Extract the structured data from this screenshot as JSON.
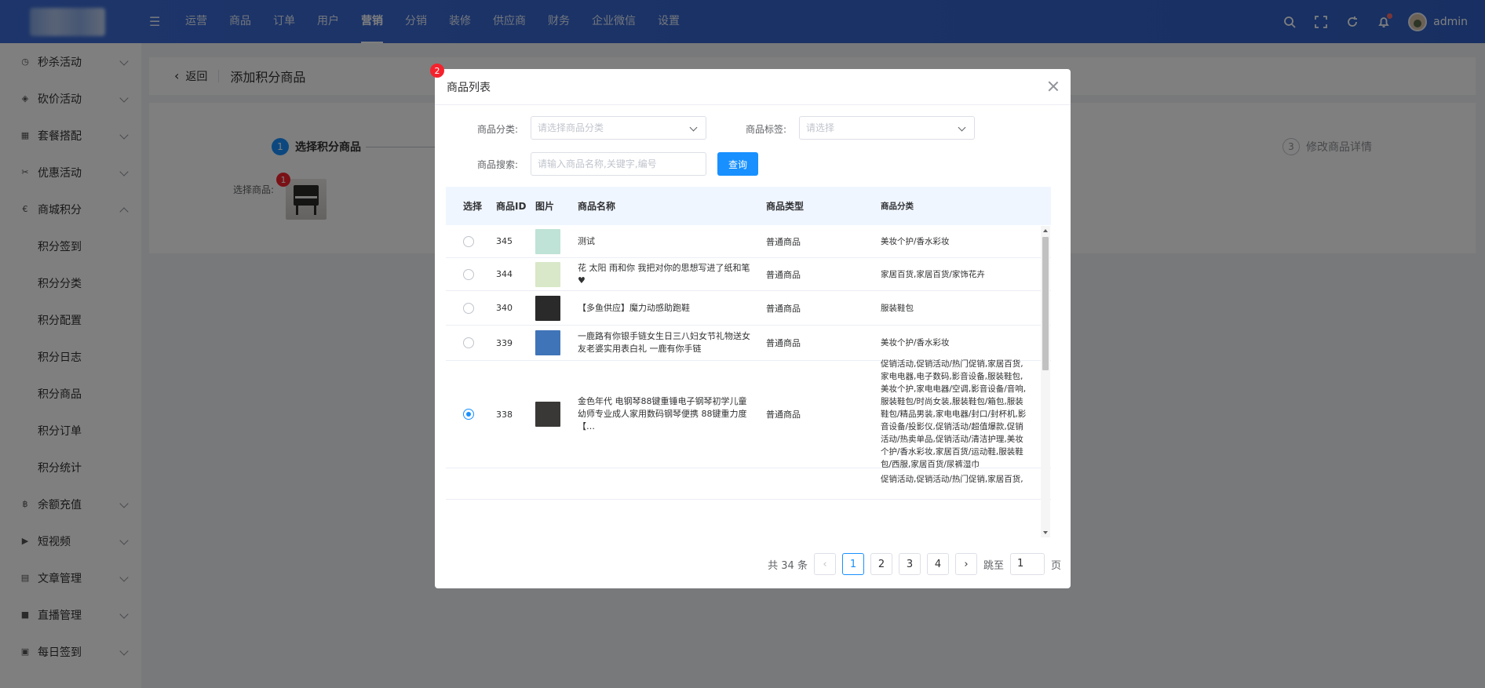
{
  "topnav": {
    "items": [
      "运营",
      "商品",
      "订单",
      "用户",
      "营销",
      "分销",
      "装修",
      "供应商",
      "财务",
      "企业微信",
      "设置"
    ],
    "active": "营销",
    "user": "admin"
  },
  "sidebar": {
    "groups": [
      {
        "label": "秒杀活动",
        "icon": "clock-icon"
      },
      {
        "label": "砍价活动",
        "icon": "tag-icon"
      },
      {
        "label": "套餐搭配",
        "icon": "box-icon"
      },
      {
        "label": "优惠活动",
        "icon": "coupon-icon"
      },
      {
        "label": "商城积分",
        "icon": "euro-icon",
        "expanded": true
      }
    ],
    "subitems": [
      "积分签到",
      "积分分类",
      "积分配置",
      "积分日志",
      "积分商品",
      "积分订单",
      "积分统计"
    ],
    "groups_after": [
      {
        "label": "余额充值",
        "icon": "bitcoin-icon"
      },
      {
        "label": "短视频",
        "icon": "video-icon"
      },
      {
        "label": "文章管理",
        "icon": "article-icon"
      },
      {
        "label": "直播管理",
        "icon": "camera-icon"
      },
      {
        "label": "每日签到",
        "icon": "calendar-icon"
      }
    ]
  },
  "page": {
    "back": "返回",
    "title": "添加积分商品",
    "step1_num": "1",
    "step1_label": "选择积分商品",
    "step3_num": "3",
    "step3_label": "修改商品详情",
    "select_label": "选择商品:",
    "badge1": "1"
  },
  "modal": {
    "title": "商品列表",
    "badge2": "2",
    "filters": {
      "category_label": "商品分类:",
      "category_placeholder": "请选择商品分类",
      "tag_label": "商品标签:",
      "tag_placeholder": "请选择",
      "search_label": "商品搜索:",
      "search_placeholder": "请输入商品名称,关键字,编号",
      "query_button": "查询"
    },
    "columns": [
      "选择",
      "商品ID",
      "图片",
      "商品名称",
      "商品类型",
      "商品分类"
    ],
    "rows": [
      {
        "id": "345",
        "name": "测试",
        "type": "普通商品",
        "category": "美妆个护/香水彩妆",
        "selected": false,
        "thumb": "#bfe3d6"
      },
      {
        "id": "344",
        "name": "花 太阳 雨和你 我把对你的思想写进了纸和笔♥",
        "type": "普通商品",
        "category": "家居百货,家居百货/家饰花卉",
        "selected": false,
        "thumb": "#d8e8c8"
      },
      {
        "id": "340",
        "name": "【多鱼供应】魔力动感助跑鞋",
        "type": "普通商品",
        "category": "服装鞋包",
        "selected": false,
        "thumb": "#2a2a2a"
      },
      {
        "id": "339",
        "name": "一鹿路有你银手链女生日三八妇女节礼物送女友老婆实用表白礼 一鹿有你手链",
        "type": "普通商品",
        "category": "美妆个护/香水彩妆",
        "selected": false,
        "thumb": "#3f74b8"
      },
      {
        "id": "338",
        "name": "金色年代 电钢琴88键重锤电子钢琴初学儿童幼师专业成人家用数码钢琴便携 88键重力度【…",
        "type": "普通商品",
        "category": "促销活动,促销活动/热门促销,家居百货,家电电器,电子数码,影音设备,服装鞋包,美妆个护,家电电器/空调,影音设备/音响,服装鞋包/时尚女装,服装鞋包/箱包,服装鞋包/精品男装,家电电器/封口/封杯机,影音设备/投影仪,促销活动/超值爆款,促销活动/热卖单品,促销活动/清洁护理,美妆个护/香水彩妆,家居百货/运动鞋,服装鞋包/西服,家居百货/尿裤湿巾",
        "selected": true,
        "thumb": "#3a3836"
      },
      {
        "id": "",
        "name": "",
        "type": "",
        "category": "促销活动,促销活动/热门促销,家居百货,",
        "selected": false,
        "thumb": ""
      }
    ],
    "pager": {
      "total": "共 34 条",
      "pages": [
        "1",
        "2",
        "3",
        "4"
      ],
      "current": "1",
      "jump_label": "跳至",
      "jump_value": "1",
      "page_unit": "页"
    }
  }
}
